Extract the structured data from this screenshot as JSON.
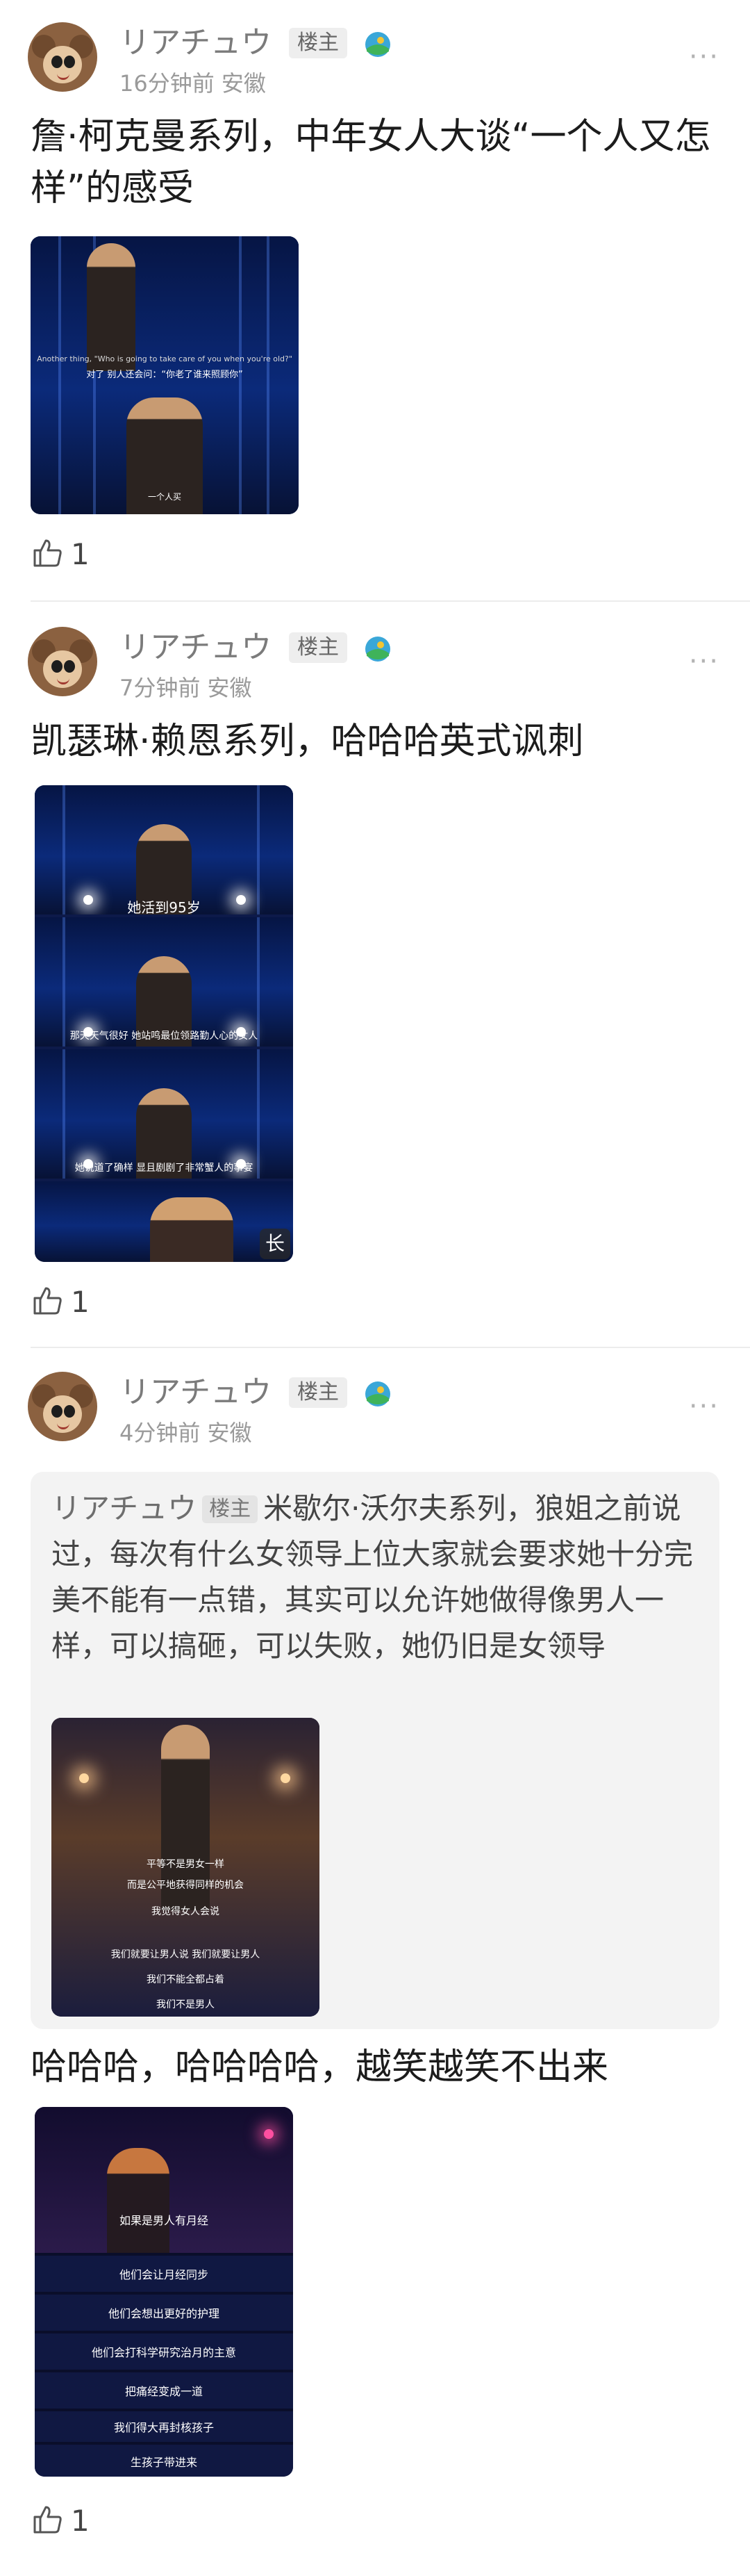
{
  "posts": [
    {
      "username": "リアチュウ",
      "badge": "楼主",
      "time": "16分钟前",
      "location": "安徽",
      "text": "詹·柯克曼系列，中年女人大谈“一个人又怎样”的感受",
      "likes": "1",
      "media_subtitles": [
        "Another thing, \"Who is going to take care of you when you're old?\"",
        "对了 别人还会问：“你老了谁来照顾你”",
        "一个人买"
      ]
    },
    {
      "username": "リアチュウ",
      "badge": "楼主",
      "time": "7分钟前",
      "location": "安徽",
      "text": "凯瑟琳·赖恩系列，哈哈哈英式讽刺",
      "likes": "1",
      "media_subtitles": [
        "她活到95岁",
        "那天天气很好 她站鸣最位领路勤人心的女人",
        "她说道了确样 显且剧剧了非常蟹人的事宴"
      ],
      "long_badge": "长"
    },
    {
      "username": "リアチュウ",
      "badge": "楼主",
      "time": "4分钟前",
      "location": "安徽",
      "quote": {
        "username": "リアチュウ",
        "badge": "楼主",
        "text": "米歇尔·沃尔夫系列，狼姐之前说过，每次有什么女领导上位大家就会要求她十分完美不能有一点错，其实可以允许她做得像男人一样，可以搞砸，可以失败，她仍旧是女领导",
        "media_subtitles": [
          "平等不是男女一样",
          "而是公平地获得同样的机会",
          "我觉得女人会说",
          "我们就要让男人说 我们就要让男人",
          "我们不能全都占着",
          "我们不是男人"
        ]
      },
      "text": "哈哈哈，哈哈哈哈，越笑越笑不出来",
      "likes": "1",
      "media_subtitles": [
        "如果是男人有月经",
        "他们会让月经同步",
        "他们会想出更好的护理",
        "他们会打科学研究治月的主意",
        "把痛经变成一道",
        "我们得大再封核孩子",
        "生孩子带进来"
      ]
    }
  ]
}
